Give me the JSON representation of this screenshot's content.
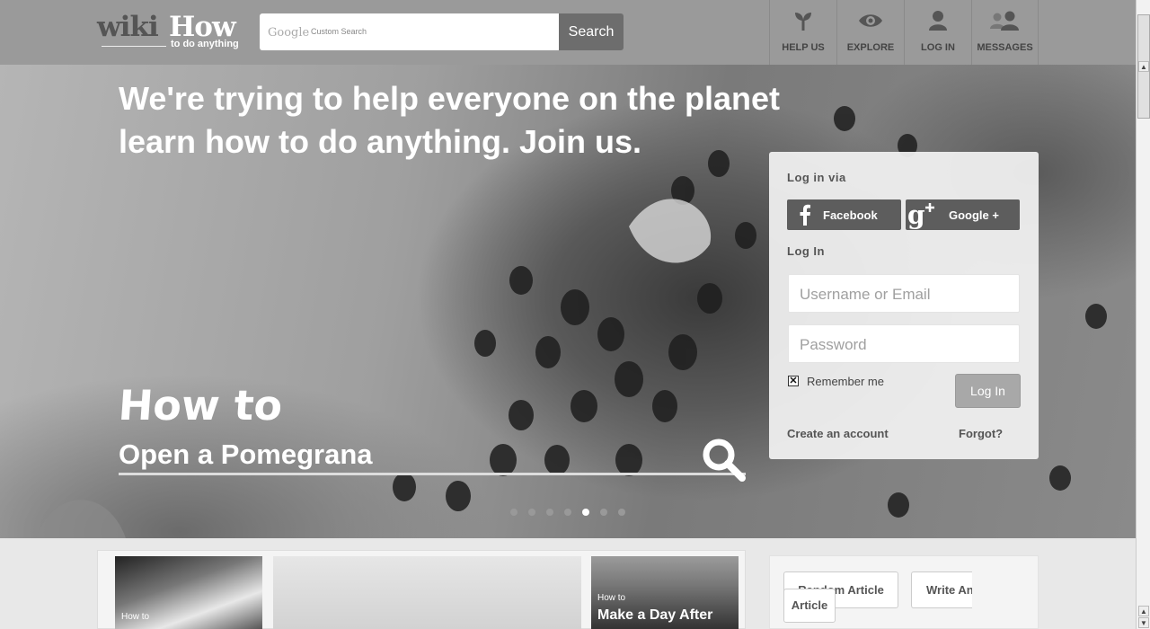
{
  "header": {
    "logo_wiki": "wiki",
    "logo_how": "How",
    "logo_tagline": "to do anything",
    "search": {
      "brand": "Google",
      "placeholder": "Custom Search",
      "button_label": "Search"
    },
    "nav": [
      {
        "label": "HELP US",
        "icon": "sprout-icon"
      },
      {
        "label": "EXPLORE",
        "icon": "eye-icon"
      },
      {
        "label": "LOG IN",
        "icon": "user-icon"
      },
      {
        "label": "MESSAGES",
        "icon": "users-icon"
      }
    ]
  },
  "hero": {
    "title": "We're trying to help everyone on the planet learn how to do anything. Join us.",
    "how_to": "How to",
    "how_to_query": "Open a Pomegrana",
    "slides_total": 7,
    "slide_active": 5
  },
  "login": {
    "via_heading": "Log in via",
    "facebook_label": "Facebook",
    "google_label": "Google +",
    "login_heading": "Log In",
    "username_placeholder": "Username or Email",
    "password_placeholder": "Password",
    "remember_label": "Remember me",
    "remember_checked": true,
    "login_button": "Log In",
    "create_account": "Create an account",
    "forgot": "Forgot?"
  },
  "featured": [
    {
      "small": "How to",
      "big": ""
    },
    {
      "small": "",
      "big": ""
    },
    {
      "small": "How to",
      "big": "Make a Day After"
    }
  ],
  "actions": {
    "random_label": "Random Article",
    "write_label": "Write An",
    "write_label_2": "Article"
  },
  "colors": {
    "header_bg": "#9a9a9a",
    "search_button": "#6d6d6d",
    "social_button": "#5d5d5d"
  }
}
